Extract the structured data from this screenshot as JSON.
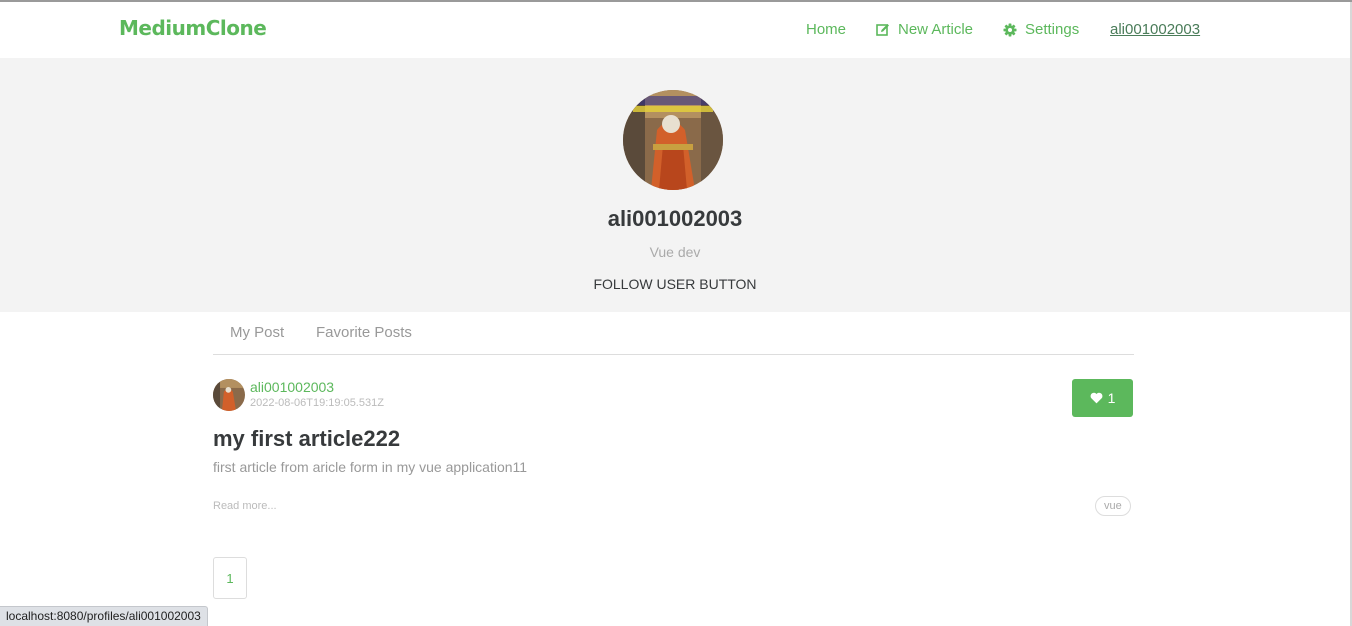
{
  "navbar": {
    "brand": "MediumClone",
    "links": {
      "home": "Home",
      "new_article": "New Article",
      "settings": "Settings",
      "username": "ali001002003"
    }
  },
  "profile": {
    "avatar_icon": "profile-avatar-image",
    "username": "ali001002003",
    "bio": "Vue dev",
    "follow_label": "FOLLOW USER BUTTON"
  },
  "tabs": {
    "my_posts": "My Post",
    "favorite_posts": "Favorite Posts"
  },
  "articles": [
    {
      "author": "ali001002003",
      "date": "2022-08-06T19:19:05.531Z",
      "favorites_count": "1",
      "title": "my first article222",
      "description": "first article from aricle form in my vue application11",
      "read_more": "Read more...",
      "tags": [
        "vue"
      ]
    }
  ],
  "pagination": {
    "current_page": "1"
  },
  "status_bar": {
    "url": "localhost:8080/profiles/ali001002003"
  },
  "colors": {
    "brand": "#5cb85c",
    "banner_bg": "#f3f3f3",
    "muted_text": "#999999"
  }
}
